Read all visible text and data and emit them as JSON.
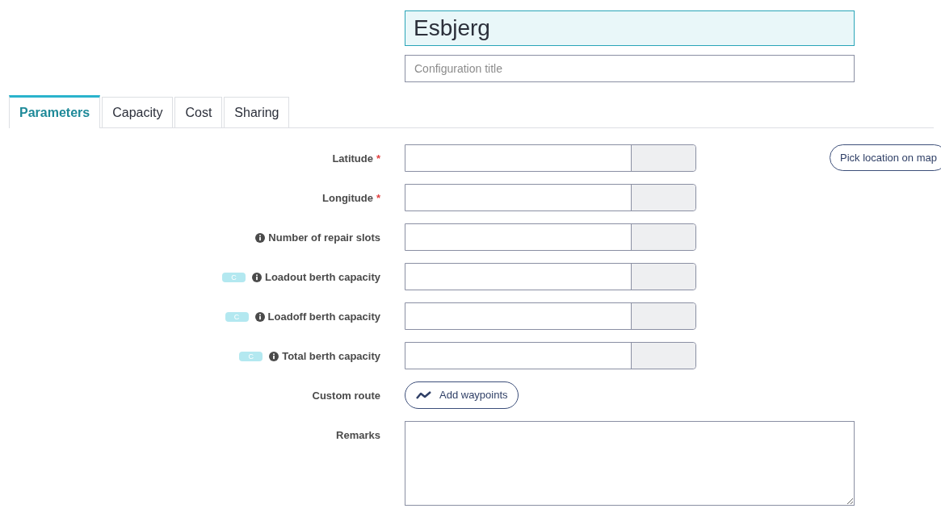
{
  "title": {
    "value": "Esbjerg"
  },
  "subtitle": {
    "placeholder": "Configuration title"
  },
  "tabs": [
    {
      "label": "Parameters",
      "selected": true
    },
    {
      "label": "Capacity",
      "selected": false
    },
    {
      "label": "Cost",
      "selected": false
    },
    {
      "label": "Sharing",
      "selected": false
    }
  ],
  "map_button": "Pick location on map",
  "rows": [
    {
      "kind": "number",
      "label": "Latitude",
      "required_mark": "*",
      "info": false
    },
    {
      "kind": "number",
      "label": "Longitude",
      "required_mark": "*",
      "info": false
    },
    {
      "kind": "number",
      "label": "Number of repair slots",
      "info": true
    },
    {
      "kind": "number",
      "label": "Loadout berth capacity",
      "info": true,
      "badge": "C"
    },
    {
      "kind": "number",
      "label": "Loadoff berth capacity",
      "info": true,
      "badge": "C"
    },
    {
      "kind": "number",
      "label": "Total berth capacity",
      "info": true,
      "badge": "C"
    },
    {
      "kind": "button",
      "label": "Custom route",
      "button": "Add waypoints"
    },
    {
      "kind": "textarea",
      "label": "Remarks"
    }
  ]
}
